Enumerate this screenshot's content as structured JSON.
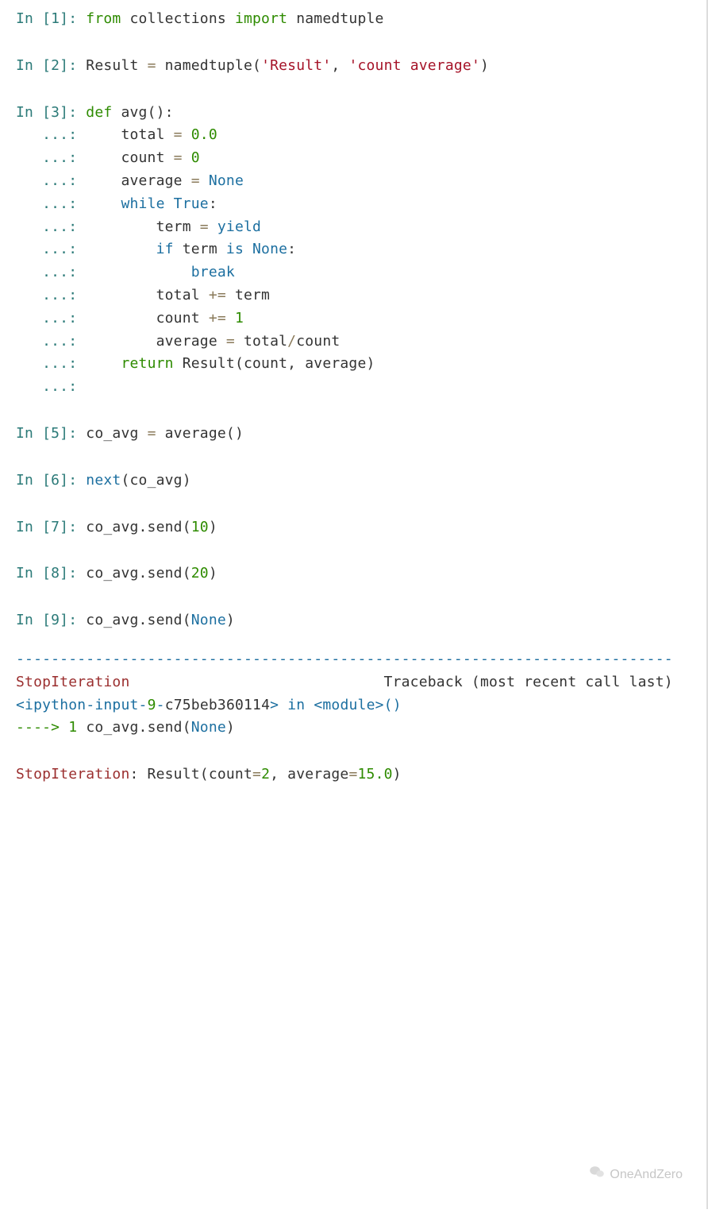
{
  "cells": {
    "c1": {
      "prompt": "In [1]: ",
      "tokens": {
        "t1": "from",
        "t2": " collections ",
        "t3": "import",
        "t4": " namedtuple"
      }
    },
    "c2": {
      "prompt": "In [2]: ",
      "tokens": {
        "t1": "Result ",
        "t2": "=",
        "t3": " namedtuple(",
        "t4": "'Result'",
        "t5": ", ",
        "t6": "'count average'",
        "t7": ")"
      }
    },
    "c3": {
      "prompt": "In [3]: ",
      "cont": "   ...: ",
      "lines": {
        "l0a": "def",
        "l0b": " avg():",
        "l1a": "    total ",
        "l1b": "=",
        "l1c": " 0.0",
        "l2a": "    count ",
        "l2b": "=",
        "l2c": " 0",
        "l3a": "    average ",
        "l3b": "=",
        "l3c": " None",
        "l4a": "    ",
        "l4b": "while",
        "l4c": " True",
        "l4d": ":",
        "l5a": "        term ",
        "l5b": "=",
        "l5c": " yield",
        "l6a": "        ",
        "l6b": "if",
        "l6c": " term ",
        "l6d": "is",
        "l6e": " None",
        "l6f": ":",
        "l7a": "            ",
        "l7b": "break",
        "l8a": "        total ",
        "l8b": "+=",
        "l8c": " term",
        "l9a": "        count ",
        "l9b": "+=",
        "l9c": " 1",
        "l10a": "        average ",
        "l10b": "=",
        "l10c": " total",
        "l10d": "/",
        "l10e": "count",
        "l11a": "    ",
        "l11b": "return",
        "l11c": " Result(count, average)"
      }
    },
    "c5": {
      "prompt": "In [5]: ",
      "t1": "co_avg ",
      "t2": "=",
      "t3": " average()"
    },
    "c6": {
      "prompt": "In [6]: ",
      "t1": "next",
      "t2": "(co_avg)"
    },
    "c7": {
      "prompt": "In [7]: ",
      "t1": "co_avg.send(",
      "t2": "10",
      "t3": ")"
    },
    "c8": {
      "prompt": "In [8]: ",
      "t1": "co_avg.send(",
      "t2": "20",
      "t3": ")"
    },
    "c9": {
      "prompt": "In [9]: ",
      "t1": "co_avg.send(",
      "t2": "None",
      "t3": ")"
    }
  },
  "traceback": {
    "sep1": "---------------------------------------------------------------",
    "sep2": "------------",
    "err": "StopIteration",
    "tb_label": "                             Traceback (most recent call last)",
    "frame": {
      "lt1": "<",
      "ip1": "ipython",
      "dash1": "-",
      "ip2": "input",
      "dash2": "-",
      "n9": "9",
      "dash3": "-",
      "hash": "c75beb360114",
      "gt1": ">",
      "in_tok": " in ",
      "lt2": "<",
      "mod": "module",
      "gt2": ">",
      "paren": "()"
    },
    "arrow": "----> ",
    "arrow_num": "1",
    "arrow_code1": " co_avg.send(",
    "arrow_code2": "None",
    "arrow_code3": ")",
    "final_err": "StopIteration",
    "final_colon": ": Result(count",
    "final_eq1": "=",
    "final_v1": "2",
    "final_mid": ", average",
    "final_eq2": "=",
    "final_v2": "15.0",
    "final_end": ")"
  },
  "watermark": "OneAndZero"
}
